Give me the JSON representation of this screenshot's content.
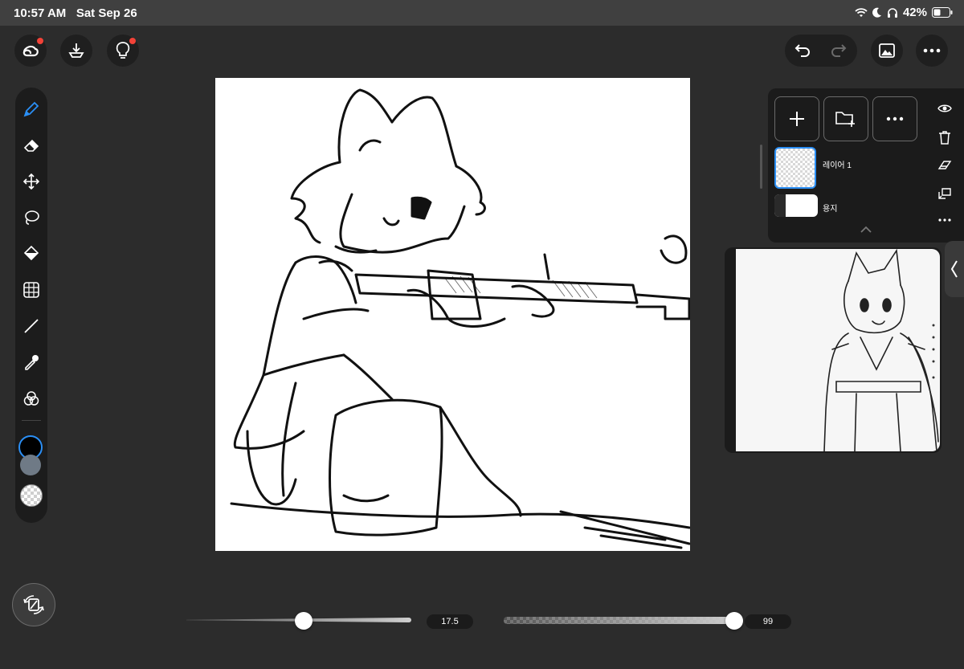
{
  "status_bar": {
    "time": "10:57 AM",
    "date": "Sat Sep 26",
    "battery_percent": "42%"
  },
  "top_left_buttons": [
    "creative-cloud-icon",
    "import-icon",
    "lightbulb-icon"
  ],
  "top_right_buttons": [
    "undo-icon",
    "redo-icon",
    "gallery-icon",
    "more-icon"
  ],
  "tools": [
    "pixel-brush-icon",
    "eraser-icon",
    "move-icon",
    "lasso-icon",
    "fill-icon",
    "grid-icon",
    "line-icon",
    "eyedropper-icon",
    "color-wheel-icon"
  ],
  "colors": {
    "primary": "#000000",
    "secondary": "#6f7a86",
    "background": "transparent",
    "accent": "#2b8ff5"
  },
  "layers": [
    {
      "name": "레이어 1",
      "selected": true
    },
    {
      "name": "용지",
      "selected": false
    }
  ],
  "sliders": {
    "size": {
      "value": "17.5",
      "fraction": 0.52
    },
    "opacity": {
      "value": "99",
      "fraction": 0.99
    }
  }
}
